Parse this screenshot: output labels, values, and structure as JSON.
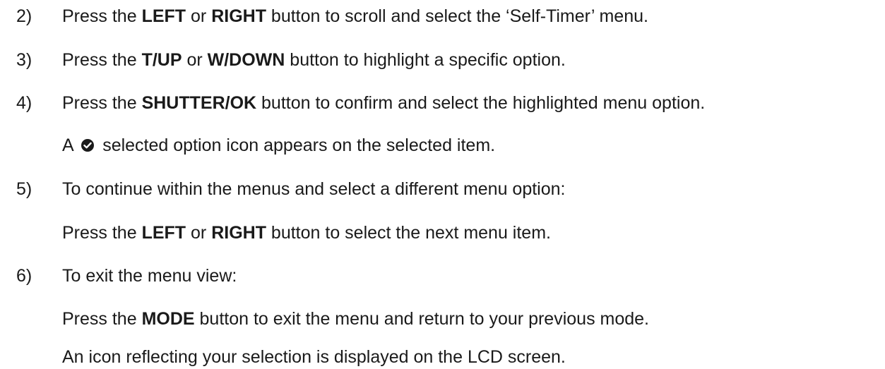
{
  "steps": [
    {
      "number": "2)",
      "pre": "Press the ",
      "b1": "LEFT",
      "mid": " or ",
      "b2": "RIGHT",
      "post": " button to scroll and select the ‘Self-Timer’ menu."
    },
    {
      "number": "3)",
      "pre": "Press the ",
      "b1": "T/UP",
      "mid": " or ",
      "b2": "W/DOWN",
      "post": " button to highlight a specific option."
    },
    {
      "number": "4)",
      "pre": "Press the ",
      "b1": "SHUTTER/OK",
      "post": " button to confirm and select the highlighted menu option.",
      "note_pre": "A ",
      "note_icon": "check-circle-icon",
      "note_post": " selected option icon appears on the selected item."
    },
    {
      "number": "5)",
      "text": "To continue within the menus and select a different menu option:",
      "sub_pre": "Press the ",
      "sub_b1": "LEFT",
      "sub_mid": " or ",
      "sub_b2": "RIGHT",
      "sub_post": " button to select the next menu item."
    },
    {
      "number": "6)",
      "text": "To exit the menu view:",
      "sub_pre": "Press the ",
      "sub_b1": "MODE",
      "sub_post": " button to exit the menu and return to your previous mode.",
      "sub2": "An icon reflecting your selection is displayed on the LCD screen."
    }
  ],
  "colors": {
    "text": "#1a1a1a",
    "icon": "#1a1a1a"
  }
}
